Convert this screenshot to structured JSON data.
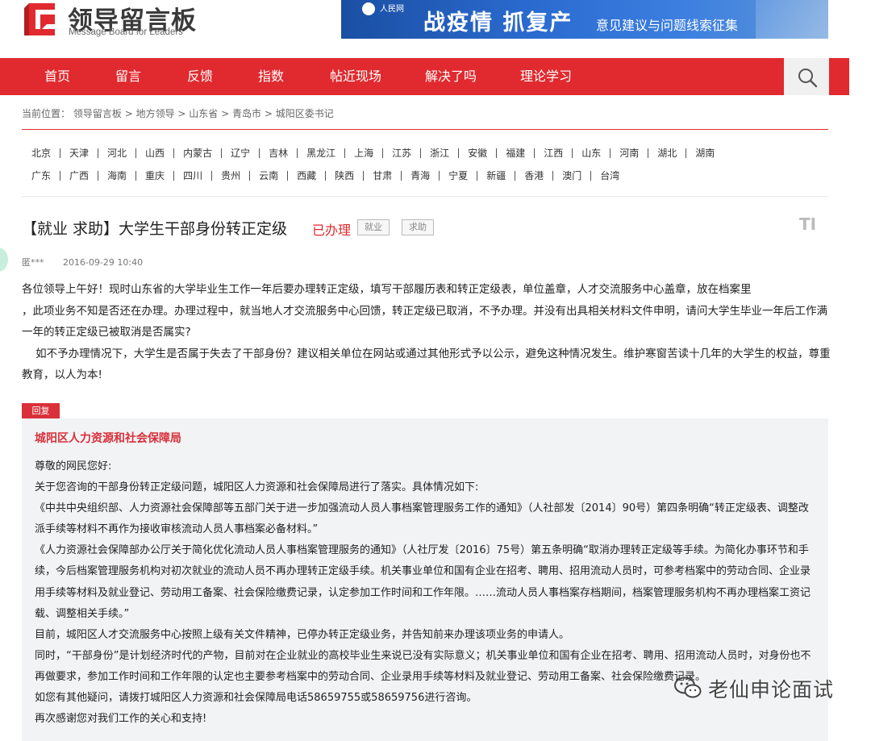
{
  "header": {
    "logo_title": "领导留言板",
    "logo_subtitle": "Message Board for Leaders",
    "banner_brand": "人民网",
    "banner_main": "战疫情  抓复产",
    "banner_sub": "意见建议与问题线索征集"
  },
  "nav": {
    "items": [
      "首页",
      "留言",
      "反馈",
      "指数",
      "帖近现场",
      "解决了吗",
      "理论学习"
    ],
    "search_icon": "search-icon"
  },
  "breadcrumb": {
    "label": "当前位置：",
    "path": [
      "领导留言板",
      "地方领导",
      "山东省",
      "青岛市",
      "城阳区委书记"
    ],
    "separator": " > "
  },
  "provinces": {
    "row1": [
      "北京",
      "天津",
      "河北",
      "山西",
      "内蒙古",
      "辽宁",
      "吉林",
      "黑龙江",
      "上海",
      "江苏",
      "浙江",
      "安徽",
      "福建",
      "江西",
      "山东",
      "河南",
      "湖北",
      "湖南"
    ],
    "row2": [
      "广东",
      "广西",
      "海南",
      "重庆",
      "四川",
      "贵州",
      "云南",
      "西藏",
      "陕西",
      "甘肃",
      "青海",
      "宁夏",
      "新疆",
      "香港",
      "澳门",
      "台湾"
    ]
  },
  "message": {
    "title": "【就业 求助】大学生干部身份转正定级",
    "status": "已办理",
    "tags": [
      "就业",
      "求助"
    ],
    "author": "匿***",
    "date": "2016-09-29 10:40",
    "text_size_icon": "TI",
    "paragraphs": [
      "各位领导上午好！现时山东省的大学毕业生工作一年后要办理转正定级，填写干部履历表和转正定级表，单位盖章，人才交流服务中心盖章，放在档案里",
      "，此项业务不知是否还在办理。办理过程中，就当地人才交流服务中心回馈，转正定级已取消，不予办理。并没有出具相关材料文件申明，请问大学生毕业一年后工作满一年的转正定级已被取消是否属实?",
      "    如不予办理情况下，大学生是否属于失去了干部身份？建议相关单位在网站或通过其他形式予以公示，避免这种情况发生。维护寒窗苦读十几年的大学生的权益，尊重教育，以人为本!"
    ]
  },
  "reply": {
    "tab_label": "回复",
    "organization": "城阳区人力资源和社会保障局",
    "paragraphs": [
      "尊敬的网民您好:",
      "关于您咨询的干部身份转正定级问题，城阳区人力资源和社会保障局进行了落实。具体情况如下:",
      "《中共中央组织部、人力资源社会保障部等五部门关于进一步加强流动人员人事档案管理服务工作的通知》（人社部发〔2014〕90号）第四条明确“转正定级表、调整改派手续等材料不再作为接收审核流动人员人事档案必备材料。”",
      "《人力资源社会保障部办公厅关于简化优化流动人员人事档案管理服务的通知》（人社厅发〔2016〕75号）第五条明确“取消办理转正定级等手续。为简化办事环节和手续，今后档案管理服务机构对初次就业的流动人员不再办理转正定级手续。机关事业单位和国有企业在招考、聘用、招用流动人员时，可参考档案中的劳动合同、企业录用手续等材料及就业登记、劳动用工备案、社会保险缴费记录，认定参加工作时间和工作年限。……流动人员人事档案存档期间，档案管理服务机构不再办理档案工资记载、调整相关手续。”",
      "目前，城阳区人才交流服务中心按照上级有关文件精神，已停办转正定级业务，并告知前来办理该项业务的申请人。",
      "同时，“干部身份”是计划经济时代的产物，目前对在企业就业的高校毕业生来说已没有实际意义；机关事业单位和国有企业在招考、聘用、招用流动人员时，对身份也不再做要求，参加工作时间和工作年限的认定也主要参考档案中的劳动合同、企业录用手续等材料及就业登记、劳动用工备案、社会保险缴费记录。",
      "如您有其他疑问，请拨打城阳区人力资源和社会保障局电话58659755或58659756进行咨询。",
      "再次感谢您对我们工作的关心和支持!"
    ]
  },
  "watermark": {
    "text": "老仙申论面试"
  },
  "colors": {
    "brand_red": "#e02a2f",
    "reply_red": "#d9303a",
    "banner_blue": "#2b6bd0",
    "reply_bg": "#f1f3f5"
  }
}
